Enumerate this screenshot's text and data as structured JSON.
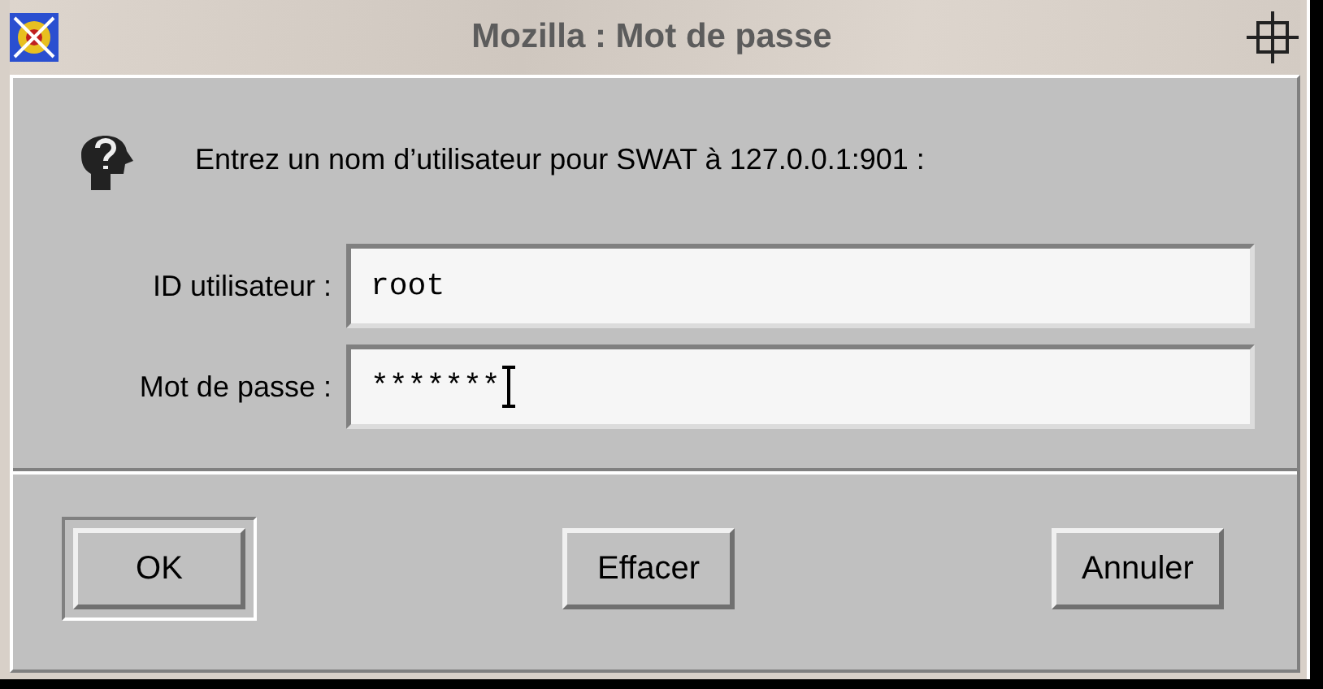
{
  "window": {
    "title": "Mozilla : Mot de passe"
  },
  "message": "Entrez un nom d’utilisateur pour SWAT à 127.0.0.1:901 :",
  "fields": [
    {
      "label": "ID utilisateur :",
      "value": "root",
      "focused": false
    },
    {
      "label": "Mot de passe :",
      "value": "*******",
      "focused": true
    }
  ],
  "buttons": [
    {
      "label": "OK",
      "default": true
    },
    {
      "label": "Effacer",
      "default": false
    },
    {
      "label": "Annuler",
      "default": false
    }
  ]
}
